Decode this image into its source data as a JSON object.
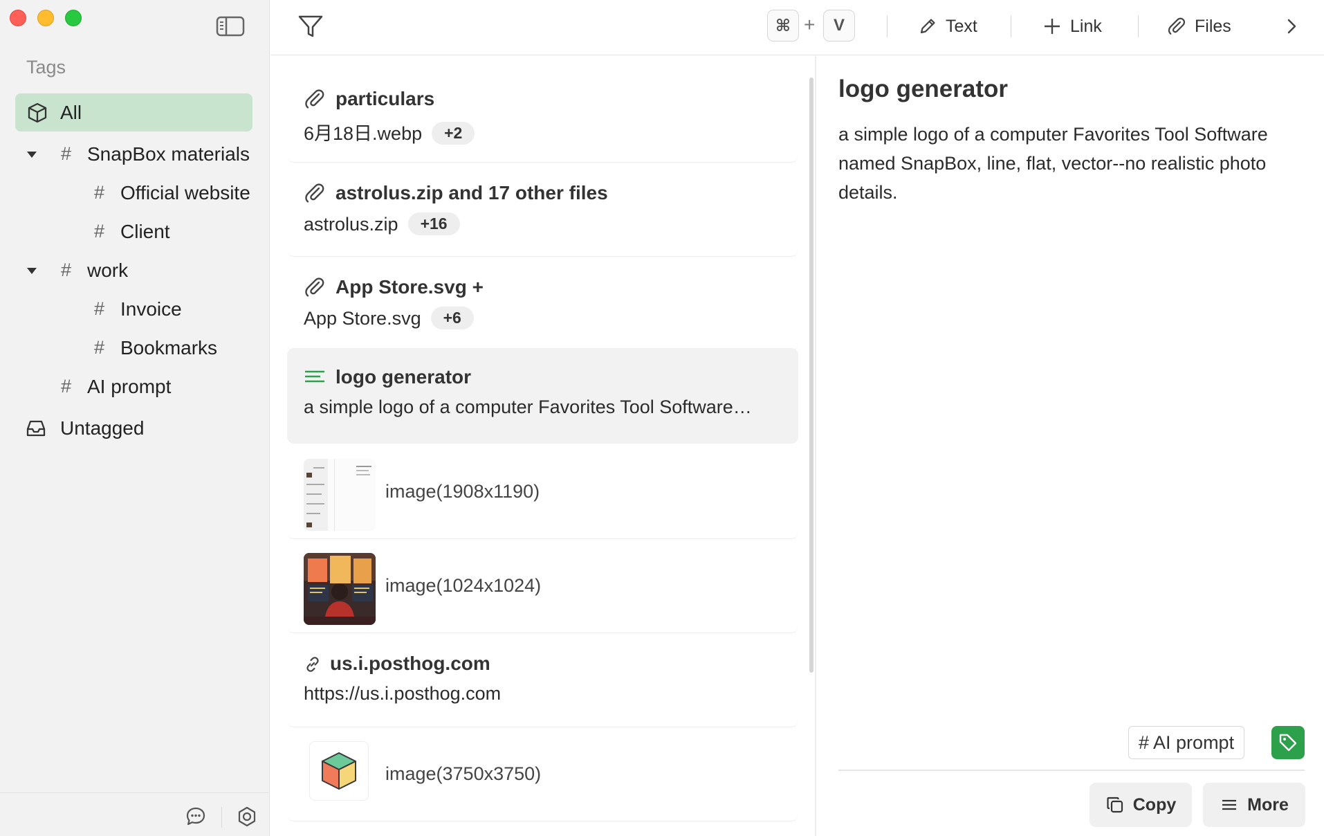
{
  "sidebar": {
    "heading": "Tags",
    "items": [
      {
        "label": "All"
      },
      {
        "label": "SnapBox materials"
      },
      {
        "label": "Official website"
      },
      {
        "label": "Client"
      },
      {
        "label": "work"
      },
      {
        "label": "Invoice"
      },
      {
        "label": "Bookmarks"
      },
      {
        "label": "AI prompt"
      },
      {
        "label": "Untagged"
      }
    ],
    "hash": "#"
  },
  "toolbar": {
    "shortcut_key1": "⌘",
    "shortcut_plus": "+",
    "shortcut_key2": "V",
    "text_label": "Text",
    "link_label": "Link",
    "files_label": "Files"
  },
  "list": {
    "items": [
      {
        "type": "files",
        "title": "particulars",
        "subtitle": "6月18日.webp",
        "badge": "+2"
      },
      {
        "type": "files",
        "title": "astrolus.zip and 17 other files",
        "subtitle": "astrolus.zip",
        "badge": "+16"
      },
      {
        "type": "files",
        "title": "App Store.svg +",
        "subtitle": "App Store.svg",
        "badge": "+6"
      },
      {
        "type": "text",
        "title": "logo generator",
        "subtitle": "a simple logo of a computer Favorites Tool Software…"
      },
      {
        "type": "image",
        "name": "image(1908x1190)"
      },
      {
        "type": "image",
        "name": "image(1024x1024)"
      },
      {
        "type": "link",
        "title": "us.i.posthog.com",
        "subtitle": "https://us.i.posthog.com"
      },
      {
        "type": "image",
        "name": "image(3750x3750)"
      }
    ]
  },
  "detail": {
    "title": "logo generator",
    "body": "a simple logo of a computer Favorites Tool Software named SnapBox, line, flat, vector--no realistic photo details.",
    "tag": "# AI prompt",
    "copy_label": "Copy",
    "more_label": "More"
  },
  "colors": {
    "accent": "#2da04b",
    "selected_tag_bg": "#c8e4cf",
    "selected_card_bg": "#f2f2f2"
  }
}
